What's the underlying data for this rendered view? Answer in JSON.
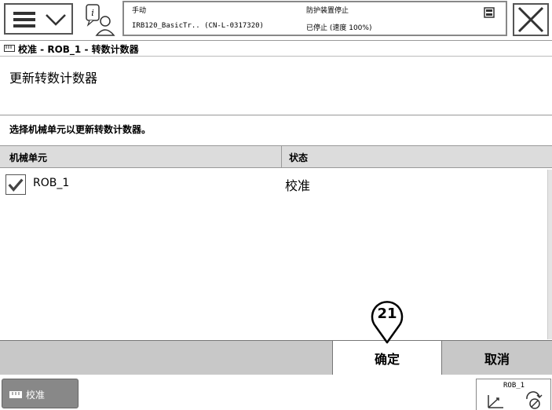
{
  "status_bar": {
    "mode": "手动",
    "system": "IRB120_BasicTr.. (CN-L-0317320)",
    "safety": "防护装置停止",
    "state": "已停止 (速度 100%)"
  },
  "title_bar": {
    "title": "校准 - ROB_1 - 转数计数器"
  },
  "page": {
    "heading": "更新转数计数器",
    "instruction": "选择机械单元以更新转数计数器。"
  },
  "table": {
    "headers": [
      "机械单元",
      "状态"
    ],
    "rows": [
      {
        "checked": true,
        "unit": "ROB_1",
        "status": "校准"
      }
    ]
  },
  "buttons": {
    "ok": "确定",
    "cancel": "取消"
  },
  "step_marker": "21",
  "taskbar": {
    "task_label": "校准",
    "quickset_label": "ROB_1"
  }
}
